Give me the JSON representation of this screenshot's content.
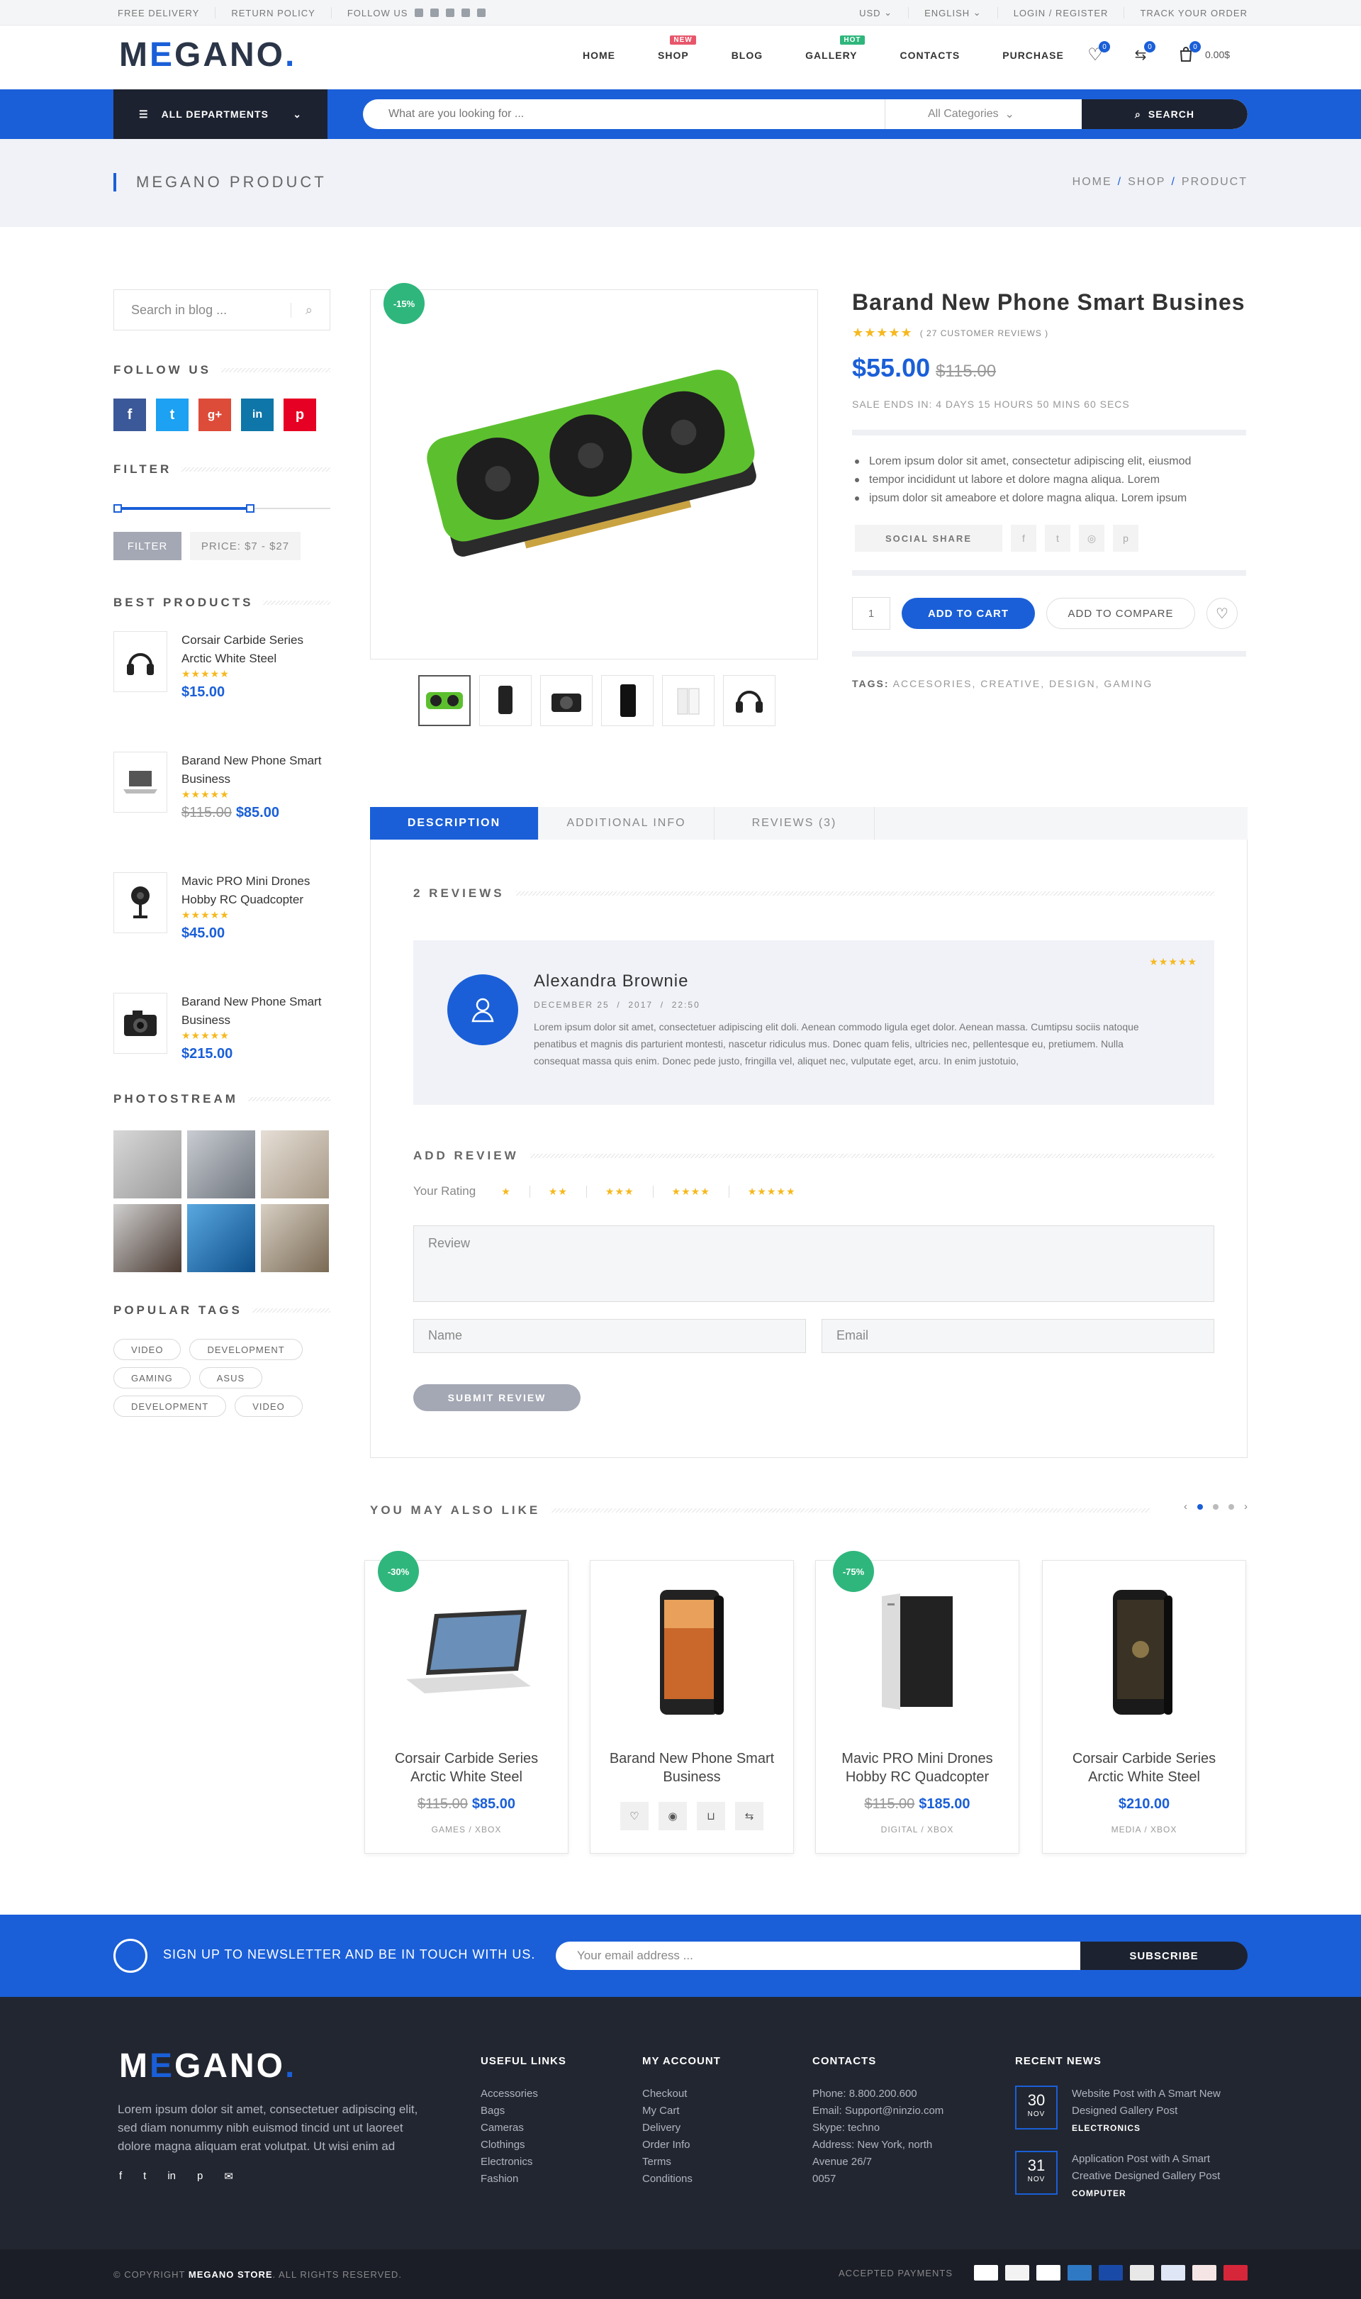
{
  "topbar": {
    "left": [
      "Free Delivery",
      "Return Policy",
      "Follow Us"
    ],
    "currency": "USD",
    "language": "English",
    "login": "Login / Register",
    "track": "Track Your Order"
  },
  "logo": "MEGANO",
  "nav": [
    {
      "label": "Home"
    },
    {
      "label": "Shop",
      "badge": "New",
      "badge_color": "#e8566b"
    },
    {
      "label": "Blog"
    },
    {
      "label": "Gallery",
      "badge": "Hot",
      "badge_color": "#2fb67c"
    },
    {
      "label": "Contacts"
    },
    {
      "label": "Purchase"
    }
  ],
  "header": {
    "wishlist_count": "0",
    "compare_count": "0",
    "cart_count": "0",
    "cart_total": "0.00$"
  },
  "departments": "All Departments",
  "search": {
    "placeholder": "What are you looking for ...",
    "category": "All Categories",
    "button": "Search"
  },
  "page_title": "Megano Product",
  "breadcrumb": [
    "Home",
    "Shop",
    "Product"
  ],
  "sidebar": {
    "search_placeholder": "Search in blog ...",
    "follow_title": "Follow Us",
    "filter_title": "Filter",
    "filter_btn": "Filter",
    "filter_price": "Price: $7 - $27",
    "filter_range": [
      0,
      0.65
    ],
    "best_title": "Best Products",
    "best": [
      {
        "name": "Corsair Carbide Series Arctic White Steel",
        "old": "",
        "price": "$15.00"
      },
      {
        "name": "Barand New Phone Smart Business",
        "old": "$115.00",
        "price": "$85.00"
      },
      {
        "name": "Mavic PRO Mini Drones Hobby RC Quadcopter",
        "old": "",
        "price": "$45.00"
      },
      {
        "name": "Barand New Phone Smart Business",
        "old": "",
        "price": "$215.00"
      }
    ],
    "photo_title": "Photostream",
    "tags_title": "Popular Tags",
    "tags": [
      "Video",
      "Development",
      "Gaming",
      "Asus",
      "Development",
      "Video"
    ]
  },
  "product": {
    "discount": "-15%",
    "title": "Barand New Phone Smart Busines",
    "reviews": "( 27 Customer Reviews )",
    "price": "$55.00",
    "old_price": "$115.00",
    "sale": "Sale ends in: 4 days 15 hours 50 mins 60 secs",
    "bullets": [
      "Lorem ipsum dolor sit amet, consectetur adipiscing elit, eiusmod",
      "tempor incididunt ut labore et dolore magna aliqua. Lorem",
      "ipsum dolor sit ameabore et dolore magna aliqua. Lorem ipsum"
    ],
    "share": "Social Share",
    "qty": "1",
    "add_to_cart": "Add to Cart",
    "add_to_compare": "Add to Compare",
    "tags_label": "Tags:",
    "tags": "Accesories, Creative, Design, Gaming"
  },
  "tabs": [
    "Description",
    "Additional Info",
    "Reviews (3)"
  ],
  "reviews_title": "2 Reviews",
  "review": {
    "name": "Alexandra Brownie",
    "date": "December 25  /  2017  /  22:50",
    "text": "Lorem ipsum dolor sit amet, consectetuer adipiscing elit doli. Aenean commodo ligula eget dolor. Aenean massa. Cumtipsu sociis natoque penatibus et magnis dis parturient montesti, nascetur ridiculus mus. Donec quam felis, ultricies nec, pellentesque eu, pretiumem. Nulla consequat massa quis enim. Donec pede justo, fringilla vel, aliquet nec, vulputate eget, arcu. In enim justotuio,"
  },
  "add_review": {
    "title": "Add Review",
    "rating_label": "Your Rating",
    "review_ph": "Review",
    "name_ph": "Name",
    "email_ph": "Email",
    "submit": "Submit Review"
  },
  "related": {
    "title": "You May Also Like",
    "items": [
      {
        "badge": "-30%",
        "name": "Corsair Carbide Series Arctic White Steel",
        "old": "$115.00",
        "price": "$85.00",
        "cat": "Games / Xbox"
      },
      {
        "badge": "",
        "name": "Barand New Phone Smart Business",
        "old": "",
        "price": "",
        "cat": ""
      },
      {
        "badge": "-75%",
        "name": "Mavic PRO Mini Drones Hobby RC Quadcopter",
        "old": "$115.00",
        "price": "$185.00",
        "cat": "Digital / Xbox"
      },
      {
        "badge": "",
        "name": "Corsair Carbide Series Arctic White Steel",
        "old": "",
        "price": "$210.00",
        "cat": "Media / Xbox"
      }
    ]
  },
  "newsletter": {
    "label": "Sign up to Newsletter and be in touch with us.",
    "placeholder": "Your email address ...",
    "button": "Subscribe"
  },
  "footer": {
    "desc": "Lorem ipsum dolor sit amet, consectetuer adipiscing elit, sed diam nonummy nibh euismod tincid  unt ut laoreet dolore magna aliquam erat volutpat. Ut wisi enim ad",
    "useful_title": "Useful Links",
    "useful": [
      "Accessories",
      "Bags",
      "Cameras",
      "Clothings",
      "Electronics",
      "Fashion"
    ],
    "account_title": "My Account",
    "account": [
      "Checkout",
      "My Cart",
      "Delivery",
      "Order Info",
      "Terms",
      "Conditions"
    ],
    "contacts_title": "Contacts",
    "contacts": [
      "Phone: 8.800.200.600",
      "Email: Support@ninzio.com",
      "Skype: techno",
      "Address: New York, north",
      "Avenue 26/7",
      "0057"
    ],
    "news_title": "Recent News",
    "news": [
      {
        "day": "30",
        "mon": "Nov",
        "title": "Website Post with A Smart New Designed Gallery Post",
        "cat": "Electronics"
      },
      {
        "day": "31",
        "mon": "Nov",
        "title": "Application Post with A Smart Creative Designed Gallery Post",
        "cat": "Computer"
      }
    ]
  },
  "copyright": {
    "pre": "© Copyright",
    "brand": "Megano Store",
    "post": ". All Rights Reserved.",
    "payments_label": "Accepted Payments"
  },
  "colors": {
    "accent": "#1a5fd8",
    "dark": "#1d2230",
    "green": "#2fb67c",
    "star": "#f6b81d"
  }
}
